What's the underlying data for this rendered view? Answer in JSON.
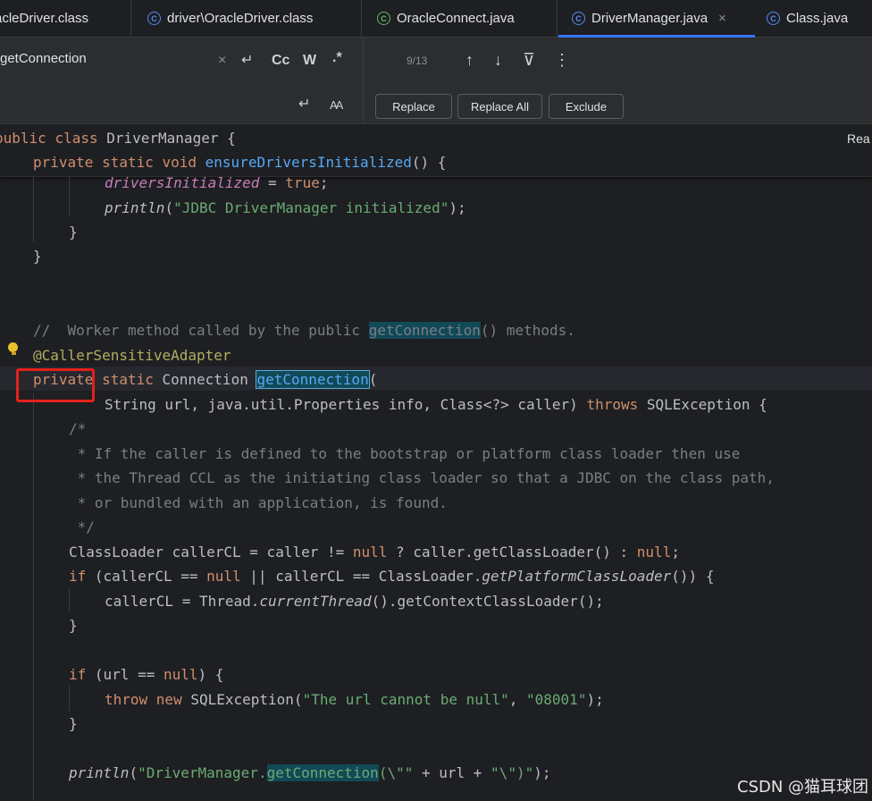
{
  "tabs": [
    {
      "label": "acleDriver.class"
    },
    {
      "label": "driver\\OracleDriver.class"
    },
    {
      "label": "OracleConnect.java"
    },
    {
      "label": "DriverManager.java"
    },
    {
      "label": "Class.java"
    }
  ],
  "close_glyph": "×",
  "find": {
    "query": "getConnection",
    "match_case": "Cc",
    "words": "W",
    "regex": ".*",
    "count": "9/13",
    "replace_label": "Replace",
    "replace_all_label": "Replace All",
    "exclude_label": "Exclude",
    "clear_glyph": "×",
    "enter_glyph": "↵",
    "up_glyph": "↑",
    "down_glyph": "↓",
    "filter_glyph": "⊽",
    "more_glyph": "⋮",
    "preserve_case_glyph": "AA"
  },
  "reader_mode": "Rea",
  "code": {
    "l1": {
      "a": "public ",
      "b": "class ",
      "c": "DriverManager {"
    },
    "l2": {
      "a": "private static void ",
      "b": "ensureDriversInitialized",
      "c": "() {"
    },
    "l3": {
      "a": "driversInitialized",
      "b": " = ",
      "c": "true",
      "d": ";"
    },
    "l4": {
      "a": "println",
      "b": "(",
      "c": "\"JDBC DriverManager initialized\"",
      "d": ");"
    },
    "l5": "}",
    "l6": "}",
    "l7": {
      "a": "//  Worker method called by the public ",
      "b": "getConnection",
      "c": "() methods."
    },
    "l8": "@CallerSensitiveAdapter",
    "l9": {
      "a": "private",
      "b": " static ",
      "c": "Connection ",
      "d": "getConnection",
      "e": "("
    },
    "l10": {
      "a": "String url, java.util.Properties info, Class<?> caller) ",
      "b": "throws",
      "c": " SQLException {"
    },
    "l11": "/*",
    "l12": " * If the caller is defined to the bootstrap or platform class loader then use",
    "l13": " * the Thread CCL as the initiating class loader so that a JDBC on the class path,",
    "l14": " * or bundled with an application, is found.",
    "l15": " */",
    "l16": {
      "a": "ClassLoader callerCL = caller != ",
      "b": "null",
      "c": " ? caller.getClassLoader() : ",
      "d": "null",
      "e": ";"
    },
    "l17": {
      "a": "if",
      "b": " (callerCL == ",
      "c": "null",
      "d": " || callerCL == ClassLoader.",
      "e": "getPlatformClassLoader",
      "f": "()) {"
    },
    "l18": {
      "a": "callerCL = Thread.",
      "b": "currentThread",
      "c": "().getContextClassLoader();"
    },
    "l19": "}",
    "l20": {
      "a": "if",
      "b": " (url == ",
      "c": "null",
      "d": ") {"
    },
    "l21": {
      "a": "throw new ",
      "b": "SQLException(",
      "c": "\"The url cannot be null\"",
      "d": ", ",
      "e": "\"08001\"",
      "f": ");"
    },
    "l22": "}",
    "l23": {
      "a": "println",
      "b": "(",
      "c": "\"DriverManager.",
      "d": "getConnection",
      "e": "(\\\"\"",
      "f": " + url + ",
      "g": "\"\\\")\"",
      "h": ");"
    }
  },
  "watermark": "CSDN @猫耳球团"
}
